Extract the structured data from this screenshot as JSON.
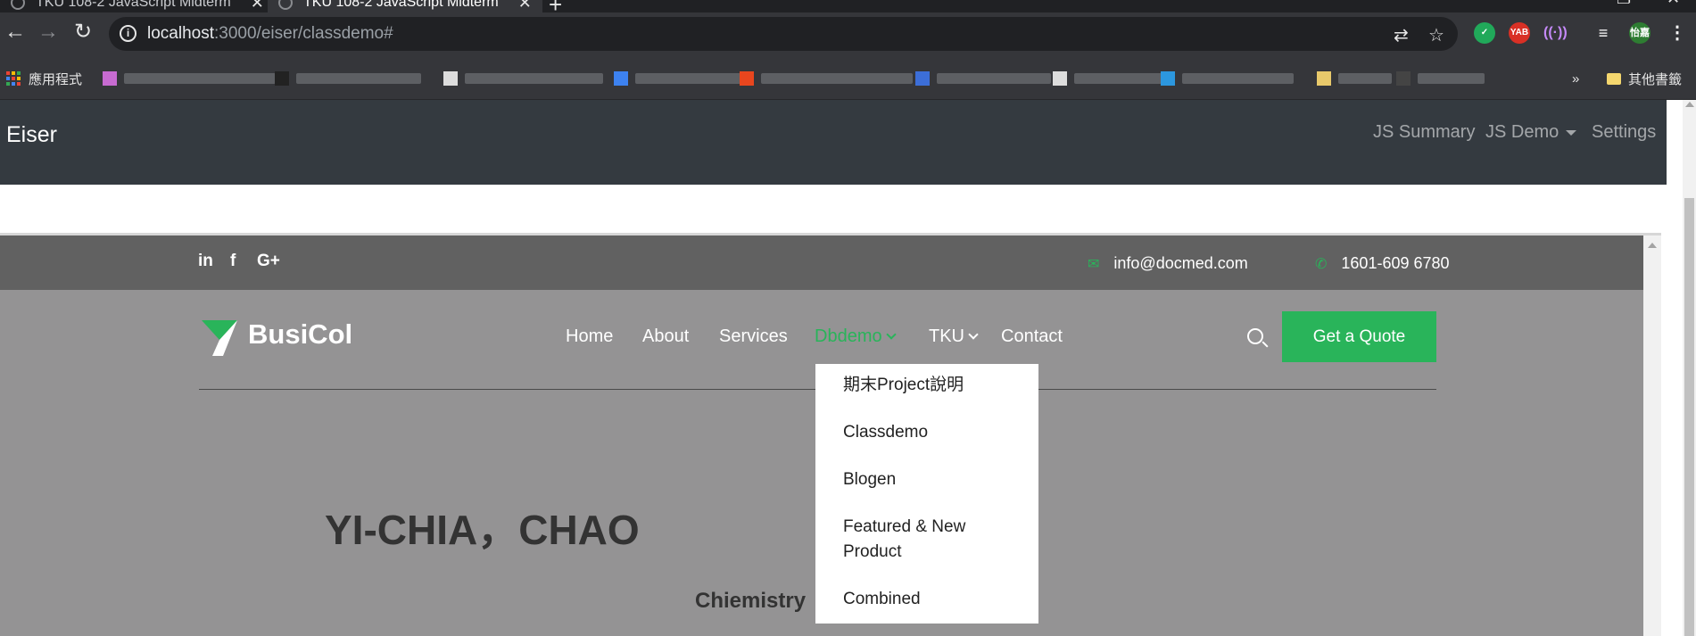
{
  "browser": {
    "tabs": [
      {
        "title": "TKU 108-2 JavaScript Midterm"
      },
      {
        "title": "TKU 108-2 JavaScript Midterm"
      }
    ],
    "url_host": "localhost",
    "url_path": ":3000/eiser/classdemo#",
    "bookmarks": {
      "apps_label": "應用程式",
      "other_label": "其他書籤",
      "overflow": "»"
    },
    "extension_avatar": "怡嘉",
    "extension_yab": "YAB"
  },
  "eiser_nav": {
    "brand": "Eiser",
    "links": [
      "JS Summary",
      "JS Demo",
      "Settings"
    ]
  },
  "site": {
    "topbar": {
      "social": [
        "in",
        "f",
        "G+"
      ],
      "email": "info@docmed.com",
      "phone": "1601-609 6780"
    },
    "logo": "BusiCol",
    "menu": [
      "Home",
      "About",
      "Services",
      "Dbdemo",
      "TKU",
      "Contact"
    ],
    "active_menu": "Dbdemo",
    "quote_button": "Get a Quote",
    "dropdown": [
      "期末Project說明",
      "Classdemo",
      "Blogen",
      "Featured & New",
      "Product",
      "Combined"
    ],
    "name": "YI-CHIA，CHAO",
    "major": "Chiemistry"
  },
  "colors": {
    "accent": "#29b45a",
    "nav_dark": "#343a40",
    "topbar": "#616161",
    "main_bg": "#949394"
  }
}
